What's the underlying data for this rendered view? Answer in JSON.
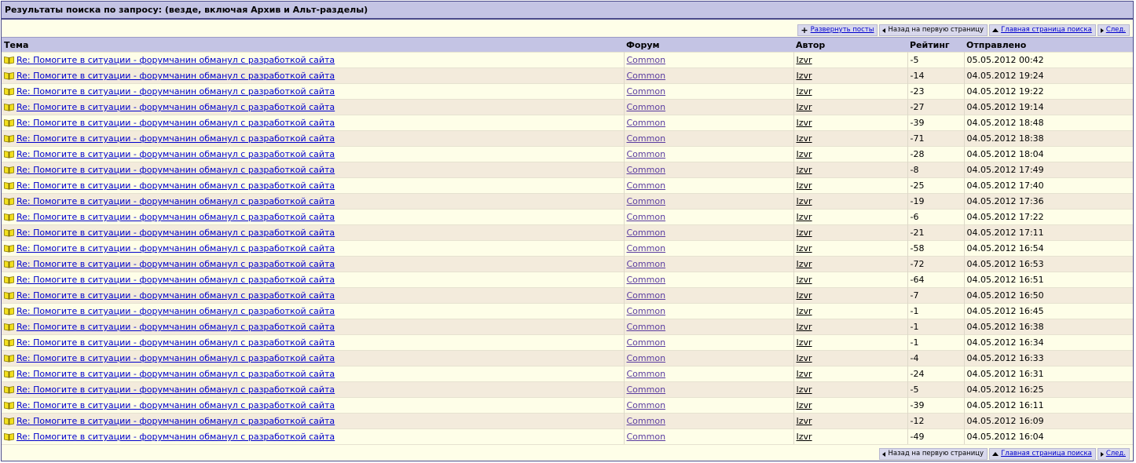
{
  "title": "Результаты поиска по запросу: (везде, включая Архив и Альт-разделы)",
  "nav_top": {
    "expand": "Развернуть посты",
    "first_page": "Назад на первую страницу",
    "search_home": "Главная страница поиска",
    "next": "След."
  },
  "nav_bottom": {
    "first_page": "Назад на первую страницу",
    "search_home": "Главная страница поиска",
    "next": "След."
  },
  "columns": {
    "topic": "Тема",
    "forum": "Форум",
    "author": "Автор",
    "rating": "Рейтинг",
    "sent": "Отправлено"
  },
  "rows": [
    {
      "topic": "Re: Помогите в ситуации - форумчанин обманул с разработкой сайта",
      "forum": "Common",
      "author": "Izvr",
      "rating": "-5",
      "sent": "05.05.2012 00:42"
    },
    {
      "topic": "Re: Помогите в ситуации - форумчанин обманул с разработкой сайта",
      "forum": "Common",
      "author": "Izvr",
      "rating": "-14",
      "sent": "04.05.2012 19:24"
    },
    {
      "topic": "Re: Помогите в ситуации - форумчанин обманул с разработкой сайта",
      "forum": "Common",
      "author": "Izvr",
      "rating": "-23",
      "sent": "04.05.2012 19:22"
    },
    {
      "topic": "Re: Помогите в ситуации - форумчанин обманул с разработкой сайта",
      "forum": "Common",
      "author": "Izvr",
      "rating": "-27",
      "sent": "04.05.2012 19:14"
    },
    {
      "topic": "Re: Помогите в ситуации - форумчанин обманул с разработкой сайта",
      "forum": "Common",
      "author": "Izvr",
      "rating": "-39",
      "sent": "04.05.2012 18:48"
    },
    {
      "topic": "Re: Помогите в ситуации - форумчанин обманул с разработкой сайта",
      "forum": "Common",
      "author": "Izvr",
      "rating": "-71",
      "sent": "04.05.2012 18:38"
    },
    {
      "topic": "Re: Помогите в ситуации - форумчанин обманул с разработкой сайта",
      "forum": "Common",
      "author": "Izvr",
      "rating": "-28",
      "sent": "04.05.2012 18:04"
    },
    {
      "topic": "Re: Помогите в ситуации - форумчанин обманул с разработкой сайта",
      "forum": "Common",
      "author": "Izvr",
      "rating": "-8",
      "sent": "04.05.2012 17:49"
    },
    {
      "topic": "Re: Помогите в ситуации - форумчанин обманул с разработкой сайта",
      "forum": "Common",
      "author": "Izvr",
      "rating": "-25",
      "sent": "04.05.2012 17:40"
    },
    {
      "topic": "Re: Помогите в ситуации - форумчанин обманул с разработкой сайта",
      "forum": "Common",
      "author": "Izvr",
      "rating": "-19",
      "sent": "04.05.2012 17:36"
    },
    {
      "topic": "Re: Помогите в ситуации - форумчанин обманул с разработкой сайта",
      "forum": "Common",
      "author": "Izvr",
      "rating": "-6",
      "sent": "04.05.2012 17:22"
    },
    {
      "topic": "Re: Помогите в ситуации - форумчанин обманул с разработкой сайта",
      "forum": "Common",
      "author": "Izvr",
      "rating": "-21",
      "sent": "04.05.2012 17:11"
    },
    {
      "topic": "Re: Помогите в ситуации - форумчанин обманул с разработкой сайта",
      "forum": "Common",
      "author": "Izvr",
      "rating": "-58",
      "sent": "04.05.2012 16:54"
    },
    {
      "topic": "Re: Помогите в ситуации - форумчанин обманул с разработкой сайта",
      "forum": "Common",
      "author": "Izvr",
      "rating": "-72",
      "sent": "04.05.2012 16:53"
    },
    {
      "topic": "Re: Помогите в ситуации - форумчанин обманул с разработкой сайта",
      "forum": "Common",
      "author": "Izvr",
      "rating": "-64",
      "sent": "04.05.2012 16:51"
    },
    {
      "topic": "Re: Помогите в ситуации - форумчанин обманул с разработкой сайта",
      "forum": "Common",
      "author": "Izvr",
      "rating": "-7",
      "sent": "04.05.2012 16:50"
    },
    {
      "topic": "Re: Помогите в ситуации - форумчанин обманул с разработкой сайта",
      "forum": "Common",
      "author": "Izvr",
      "rating": "-1",
      "sent": "04.05.2012 16:45"
    },
    {
      "topic": "Re: Помогите в ситуации - форумчанин обманул с разработкой сайта",
      "forum": "Common",
      "author": "Izvr",
      "rating": "-1",
      "sent": "04.05.2012 16:38"
    },
    {
      "topic": "Re: Помогите в ситуации - форумчанин обманул с разработкой сайта",
      "forum": "Common",
      "author": "Izvr",
      "rating": "-1",
      "sent": "04.05.2012 16:34"
    },
    {
      "topic": "Re: Помогите в ситуации - форумчанин обманул с разработкой сайта",
      "forum": "Common",
      "author": "Izvr",
      "rating": "-4",
      "sent": "04.05.2012 16:33"
    },
    {
      "topic": "Re: Помогите в ситуации - форумчанин обманул с разработкой сайта",
      "forum": "Common",
      "author": "Izvr",
      "rating": "-24",
      "sent": "04.05.2012 16:31"
    },
    {
      "topic": "Re: Помогите в ситуации - форумчанин обманул с разработкой сайта",
      "forum": "Common",
      "author": "Izvr",
      "rating": "-5",
      "sent": "04.05.2012 16:25"
    },
    {
      "topic": "Re: Помогите в ситуации - форумчанин обманул с разработкой сайта",
      "forum": "Common",
      "author": "Izvr",
      "rating": "-39",
      "sent": "04.05.2012 16:11"
    },
    {
      "topic": "Re: Помогите в ситуации - форумчанин обманул с разработкой сайта",
      "forum": "Common",
      "author": "Izvr",
      "rating": "-12",
      "sent": "04.05.2012 16:09"
    },
    {
      "topic": "Re: Помогите в ситуации - форумчанин обманул с разработкой сайта",
      "forum": "Common",
      "author": "Izvr",
      "rating": "-49",
      "sent": "04.05.2012 16:04"
    }
  ]
}
